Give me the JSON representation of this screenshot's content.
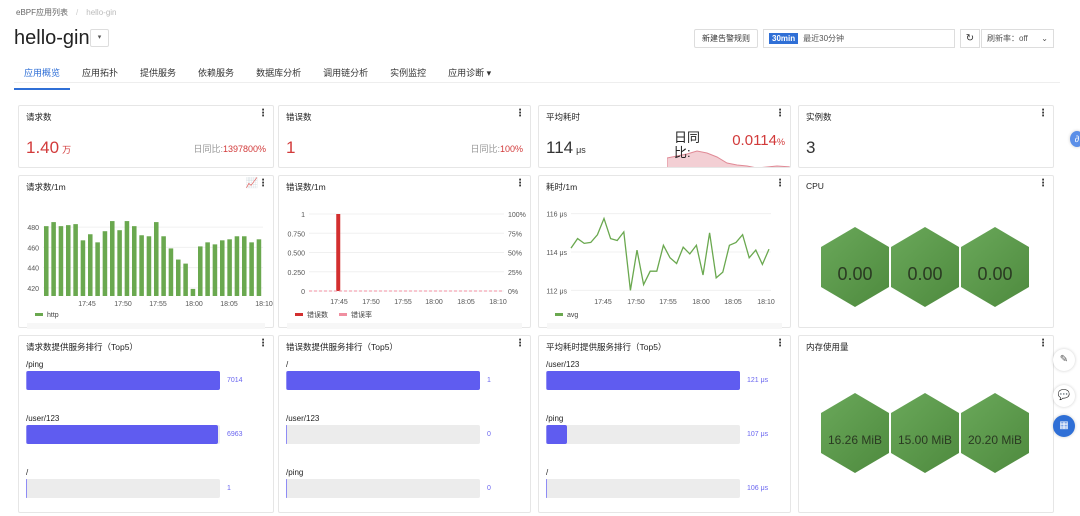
{
  "breadcrumb": {
    "root": "eBPF应用列表",
    "current": "hello-gin"
  },
  "app_title": "hello-gin",
  "tabs": [
    "应用概览",
    "应用拓扑",
    "提供服务",
    "依赖服务",
    "数据库分析",
    "调用链分析",
    "实例监控",
    "应用诊断 ▾"
  ],
  "toolbar": {
    "new_alert": "新建告警规则",
    "time_tag": "30min",
    "time_label": "最近30分钟",
    "refresh_rate": "刷新率：off"
  },
  "stats": {
    "requests": {
      "title": "请求数",
      "value": "1.40",
      "unit": "万",
      "cmp_label": "日同比:",
      "cmp_value": "1397800%"
    },
    "errors": {
      "title": "错误数",
      "value": "1",
      "cmp_label": "日同比:",
      "cmp_value": "100%"
    },
    "latency": {
      "title": "平均耗时",
      "value": "114",
      "unit": "μs",
      "cmp_label": "日同比:",
      "cmp_value": "0.0114",
      "cmp_unit": "%"
    },
    "instances": {
      "title": "实例数",
      "value": "3"
    }
  },
  "chart_data": [
    {
      "type": "bar",
      "title": "请求数/1m",
      "legend": [
        "http"
      ],
      "color": "#6aa84f",
      "ylim": [
        412,
        493
      ],
      "yticks": [
        420,
        440,
        460,
        480
      ],
      "xticks": [
        "17:45",
        "17:50",
        "17:55",
        "18:00",
        "18:05",
        "18:10"
      ],
      "values": [
        481,
        485,
        481,
        482,
        483,
        467,
        473,
        465,
        476,
        486,
        477,
        486,
        481,
        472,
        471,
        485,
        471,
        459,
        448,
        444,
        419,
        461,
        465,
        463,
        467,
        468,
        471,
        471,
        465,
        468
      ]
    },
    {
      "type": "bar",
      "title": "错误数/1m",
      "legend": [
        "错误数",
        "错误率"
      ],
      "colors": [
        "#d32f2f",
        "#f08fa0"
      ],
      "ylim": [
        0,
        1
      ],
      "yticks": [
        "0",
        "0.250",
        "0.500",
        "0.750",
        "1"
      ],
      "y2ticks": [
        "0%",
        "25%",
        "50%",
        "75%",
        "100%"
      ],
      "xticks": [
        "17:45",
        "17:50",
        "17:55",
        "18:00",
        "18:05",
        "18:10"
      ],
      "values": [
        0,
        0,
        0,
        0,
        1,
        0,
        0,
        0,
        0,
        0,
        0,
        0,
        0,
        0,
        0,
        0,
        0,
        0,
        0,
        0,
        0,
        0,
        0,
        0,
        0,
        0,
        0,
        0,
        0,
        0
      ]
    },
    {
      "type": "line",
      "title": "耗时/1m",
      "legend": [
        "avg"
      ],
      "color": "#6aa84f",
      "ylim": [
        111.6,
        116.4
      ],
      "yticks": [
        "112 μs",
        "114 μs",
        "116 μs"
      ],
      "xticks": [
        "17:45",
        "17:50",
        "17:55",
        "18:00",
        "18:05",
        "18:10"
      ],
      "values": [
        114.2,
        114.7,
        114.45,
        114.5,
        114.9,
        115.75,
        114.7,
        114.6,
        115.05,
        112,
        114.1,
        112.3,
        113,
        113,
        114.35,
        113.7,
        113.4,
        114.25,
        113.9,
        114.35,
        112.8,
        115,
        112.65,
        112.95,
        114.35,
        114.5,
        114.9,
        113.7,
        114.1,
        113.35,
        114.15
      ]
    }
  ],
  "cpu": {
    "title": "CPU",
    "values": [
      "0.00",
      "0.00",
      "0.00"
    ]
  },
  "memory": {
    "title": "内存使用量",
    "values": [
      "16.26 MiB",
      "15.00 MiB",
      "20.20 MiB"
    ]
  },
  "rankings": [
    {
      "title": "请求数提供服务排行（Top5）",
      "items": [
        {
          "name": "/ping",
          "value": "7014",
          "pct": 100
        },
        {
          "name": "/user/123",
          "value": "6963",
          "pct": 99
        },
        {
          "name": "/",
          "value": "1",
          "pct": 0.5
        }
      ]
    },
    {
      "title": "错误数提供服务排行（Top5）",
      "items": [
        {
          "name": "/",
          "value": "1",
          "pct": 100
        },
        {
          "name": "/user/123",
          "value": "0",
          "pct": 0.5
        },
        {
          "name": "/ping",
          "value": "0",
          "pct": 0.5
        }
      ]
    },
    {
      "title": "平均耗时提供服务排行（Top5）",
      "items": [
        {
          "name": "/user/123",
          "value": "121 μs",
          "pct": 100
        },
        {
          "name": "/ping",
          "value": "107 μs",
          "pct": 11
        },
        {
          "name": "/",
          "value": "106 μs",
          "pct": 0.5
        }
      ]
    }
  ]
}
